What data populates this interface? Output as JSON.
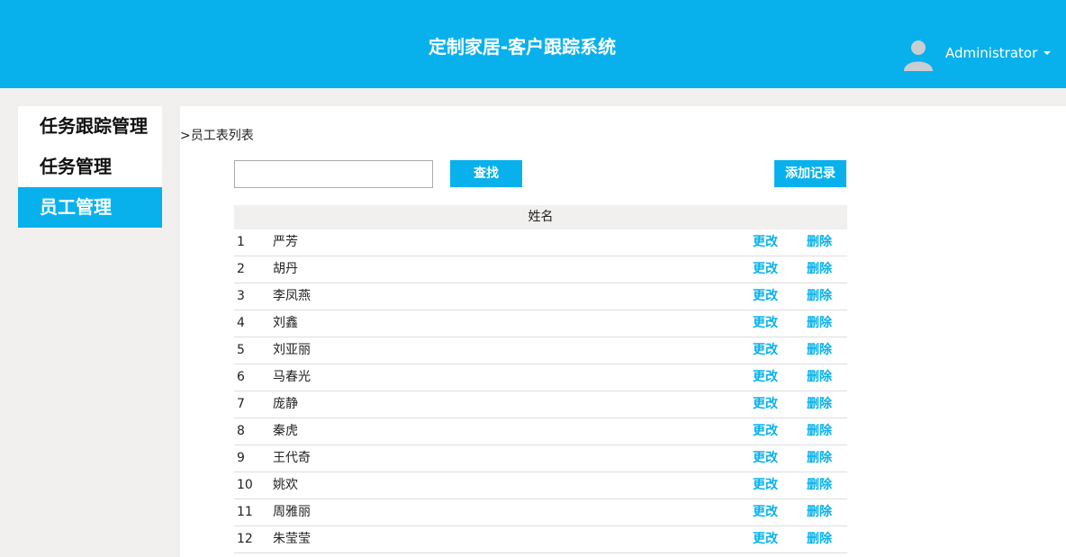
{
  "header": {
    "title": "定制家居-客户跟踪系统",
    "user_name": "Administrator"
  },
  "sidebar": {
    "items": [
      {
        "label": "任务跟踪管理"
      },
      {
        "label": "任务管理"
      },
      {
        "label": "员工管理",
        "active": true
      }
    ]
  },
  "main": {
    "breadcrumb": ">员工表列表",
    "search": {
      "value": "",
      "placeholder": ""
    },
    "search_button": "查找",
    "add_button": "添加记录",
    "table": {
      "header": "姓名",
      "edit_label": "更改",
      "delete_label": "删除",
      "rows": [
        {
          "no": "1",
          "name": "严芳"
        },
        {
          "no": "2",
          "name": "胡丹"
        },
        {
          "no": "3",
          "name": "李凤燕"
        },
        {
          "no": "4",
          "name": "刘鑫"
        },
        {
          "no": "5",
          "name": "刘亚丽"
        },
        {
          "no": "6",
          "name": "马春光"
        },
        {
          "no": "7",
          "name": "庞静"
        },
        {
          "no": "8",
          "name": "秦虎"
        },
        {
          "no": "9",
          "name": "王代奇"
        },
        {
          "no": "10",
          "name": "姚欢"
        },
        {
          "no": "11",
          "name": "周雅丽"
        },
        {
          "no": "12",
          "name": "朱莹莹"
        }
      ]
    }
  },
  "colors": {
    "accent": "#08b1ec",
    "page_bg": "#f1f0ee",
    "header_text": "#ffffff"
  },
  "icons": {
    "avatar": "user-avatar-icon",
    "caret": "caret-down-icon"
  }
}
